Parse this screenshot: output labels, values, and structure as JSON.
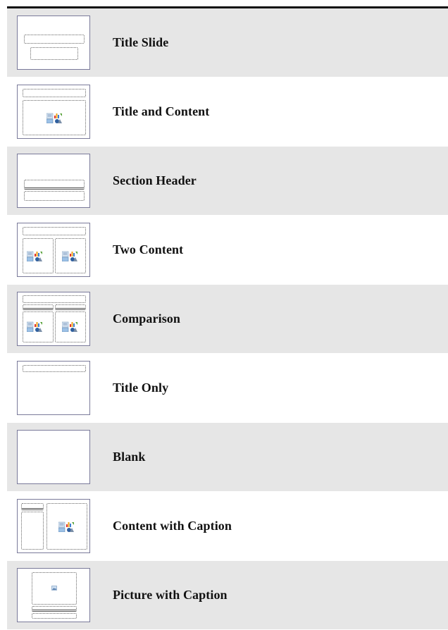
{
  "layouts": [
    {
      "label": "Title Slide",
      "thumb": "title-slide"
    },
    {
      "label": "Title and Content",
      "thumb": "title-and-content"
    },
    {
      "label": "Section Header",
      "thumb": "section-header"
    },
    {
      "label": "Two Content",
      "thumb": "two-content"
    },
    {
      "label": "Comparison",
      "thumb": "comparison"
    },
    {
      "label": "Title Only",
      "thumb": "title-only"
    },
    {
      "label": "Blank",
      "thumb": "blank"
    },
    {
      "label": "Content with Caption",
      "thumb": "content-with-caption"
    },
    {
      "label": "Picture with Caption",
      "thumb": "picture-with-caption"
    }
  ],
  "icons": {
    "content": "content-insert-icon",
    "picture": "picture-icon"
  },
  "colors": {
    "row_shaded": "#e6e6e6",
    "row_plain": "#ffffff",
    "thumb_border": "#7a7a9a",
    "rule": "#111111"
  }
}
